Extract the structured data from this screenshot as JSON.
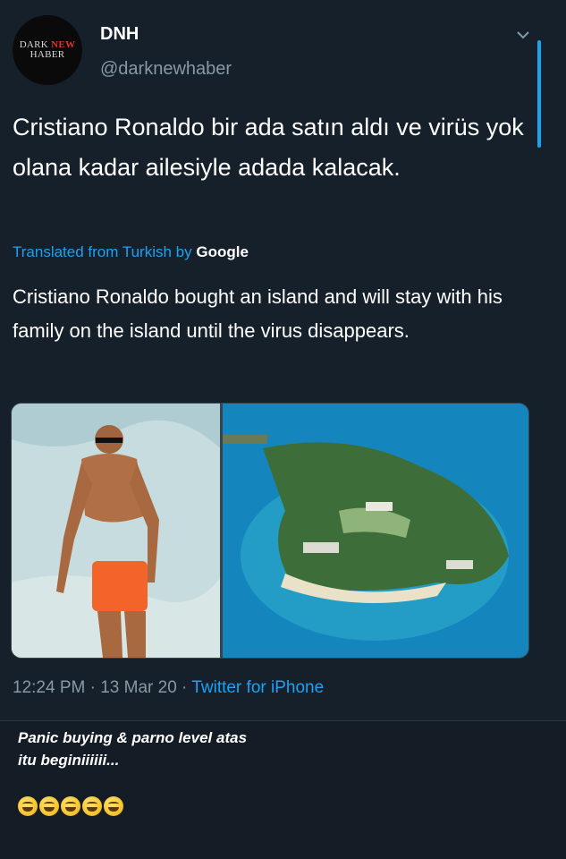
{
  "tweet": {
    "avatar": {
      "line1": "DARK",
      "line1_accent": "NEW",
      "line2": "HABER"
    },
    "author_name": "DNH",
    "author_handle": "@darknewhaber",
    "original_text": "Cristiano Ronaldo bir ada satın aldı ve virüs yok olana kadar ailesiyle adada kalacak.",
    "translated_label": "Translated from Turkish by",
    "translator": "Google",
    "translated_text": "Cristiano Ronaldo bought an island and will stay with his family on the island until the virus disappears.",
    "time": "12:24 PM",
    "date": "13 Mar 20",
    "source": "Twitter for iPhone",
    "separator": "·",
    "colors": {
      "accent": "#1da1f2",
      "background": "#15202b",
      "muted": "#8899a6"
    }
  },
  "caption": {
    "line1": "Panic buying & parno level atas",
    "line2": "itu beginiiiiii...",
    "emoji_count": 5
  }
}
